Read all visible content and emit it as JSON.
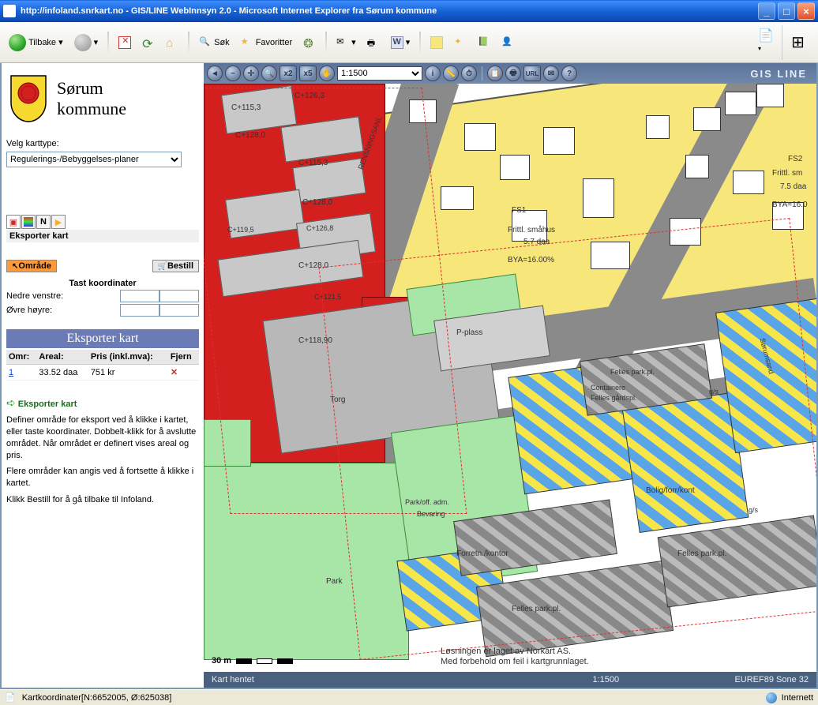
{
  "window": {
    "title": "http://infoland.snrkart.no - GIS/LINE WebInnsyn 2.0 - Microsoft Internet Explorer fra Sørum kommune"
  },
  "ie": {
    "back": "Tilbake",
    "search": "Søk",
    "favorites": "Favoritter"
  },
  "sidebar": {
    "kommune_line1": "Sørum",
    "kommune_line2": "kommune",
    "karttype_label": "Velg karttype:",
    "karttype_value": "Regulerings-/Bebyggelses-planer",
    "export_label": "Eksporter kart",
    "tab_omrade": "Område",
    "tab_bestill": "Bestill",
    "coord_header": "Tast koordinater",
    "coord_ll": "Nedre venstre:",
    "coord_ur": "Øvre høyre:",
    "table_hdr_omr": "Omr:",
    "table_hdr_areal": "Areal:",
    "table_hdr_pris": "Pris (inkl.mva):",
    "table_hdr_fjern": "Fjern",
    "row_id": "1",
    "row_areal": "33.52 daa",
    "row_pris": "751 kr",
    "help_title": "Eksporter kart",
    "help_p1": "Definer område for eksport ved å klikke i kartet, eller taste koordinater. Dobbelt-klikk for å avslutte området. Når området er definert vises areal og pris.",
    "help_p2": "Flere områder kan angis ved å fortsette å klikke i kartet.",
    "help_p3": "Klikk Bestill for å gå tilbake til Infoland."
  },
  "map": {
    "scale_value": "1:1500",
    "brand": "GIS LINE",
    "status_left": "Kart hentet",
    "status_scale": "1:1500",
    "status_proj": "EUREF89 Sone 32",
    "labels": {
      "c1153": "C+115,3",
      "c1263": "C+126,3",
      "c1280": "C+128,0",
      "c1153b": "C+115,3",
      "c1280b": "C+128,0",
      "c1195": "C+119,5",
      "c1268": "C+126,8",
      "c1280c": "C+128,0",
      "c1215": "C+121,5",
      "c1189": "C+118,90",
      "fs1": "FS1",
      "fs1_a": "Frittl. småhus",
      "fs1_b": "5.7 daa",
      "fs1_c": "BYA=16.00%",
      "fs2": "FS2",
      "fs2_a": "Frittl. sm",
      "fs2_b": "7.5 daa",
      "fs2_c": "BYA=16.0",
      "pplass": "P-plass",
      "torg": "Torg",
      "felles_pp": "Felles park.pl.",
      "cont": "Containere",
      "fgard": "Felles gårdspl.",
      "bolig": "Bolig/forr/kont",
      "forretn": "Forretn./kontor",
      "felles_pp2": "Felles park.pl.",
      "felles_pp3": "Felles park.pl.",
      "park": "Park",
      "park_adm": "Park/off. adm.",
      "bevaring": "Bevaring",
      "gs": "g/s",
      "gs2": "g/s",
      "sims": "Sørumsand",
      "ren": "RENSNINGSANL",
      "scale_txt": "30 m"
    },
    "credit1": "Løsningen er laget av Norkart AS.",
    "credit2": "Med forbehold om feil i kartgrunnlaget."
  },
  "statusbar": {
    "coords": "Kartkoordinater[N:6652005, Ø:625038]",
    "net": "Internett"
  }
}
